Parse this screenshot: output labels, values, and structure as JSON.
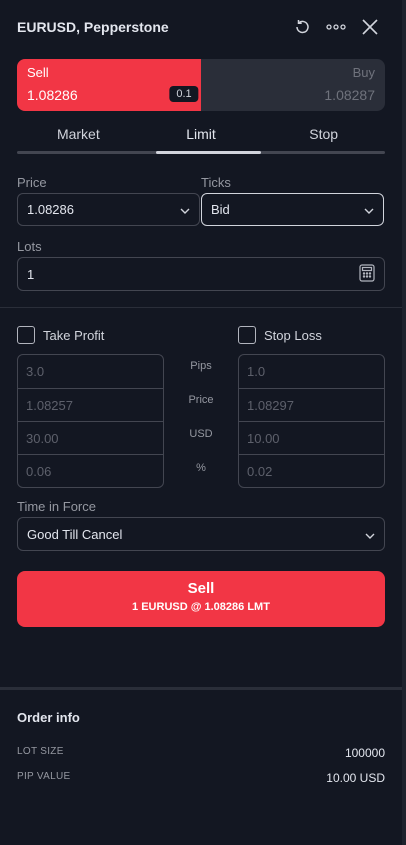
{
  "header": {
    "title": "EURUSD, Pepperstone"
  },
  "trade": {
    "sell_label": "Sell",
    "sell_price": "1.08286",
    "buy_label": "Buy",
    "buy_price": "1.08287",
    "spread": "0.1"
  },
  "tabs": [
    {
      "label": "Market"
    },
    {
      "label": "Limit"
    },
    {
      "label": "Stop"
    }
  ],
  "order": {
    "price_label": "Price",
    "price_value": "1.08286",
    "ticks_label": "Ticks",
    "ticks_value": "Bid",
    "lots_label": "Lots",
    "lots_value": "1"
  },
  "take_profit": {
    "label": "Take Profit",
    "pips": "3.0",
    "price": "1.08257",
    "usd": "30.00",
    "percent": "0.06"
  },
  "stop_loss": {
    "label": "Stop Loss",
    "pips": "1.0",
    "price": "1.08297",
    "usd": "10.00",
    "percent": "0.02"
  },
  "row_labels": {
    "pips": "Pips",
    "price": "Price",
    "usd": "USD",
    "percent": "%"
  },
  "time_in_force": {
    "label": "Time in Force",
    "value": "Good Till Cancel"
  },
  "submit": {
    "main": "Sell",
    "sub": "1 EURUSD @ 1.08286 LMT"
  },
  "order_info": {
    "title": "Order info",
    "lot_size_key": "LOT SIZE",
    "lot_size_val": "100000",
    "pip_value_key": "PIP VALUE",
    "pip_value_val": "10.00 USD"
  },
  "icons": {
    "reset": "reset-icon",
    "more": "more-icon",
    "close": "close-icon",
    "calculator": "calculator-icon",
    "chevron": "chevron-down-icon"
  },
  "colors": {
    "sell": "#f23645",
    "background": "#131722",
    "buy_inactive": "#2a2e39"
  }
}
